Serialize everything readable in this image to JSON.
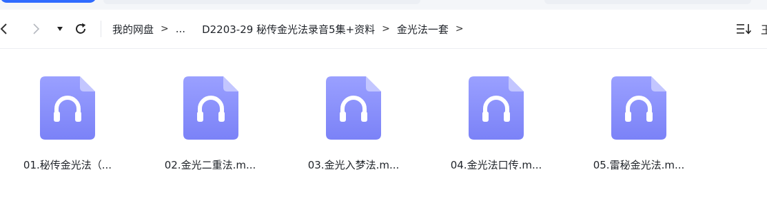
{
  "navigation": {
    "back_icon": "chevron-left-icon",
    "forward_icon": "chevron-right-icon",
    "dropdown_icon": "caret-down-icon",
    "refresh_icon": "refresh-icon"
  },
  "breadcrumb": {
    "items": [
      "我的网盘",
      "...",
      "D2203-29 秘传金光法录音5集+资料",
      "金光法一套"
    ],
    "separator": ">"
  },
  "toolbar": {
    "sort_icon": "sort-list-icon",
    "more_label": "王"
  },
  "files": [
    {
      "name": "01.秘传金光法（...",
      "icon": "audio-file-icon"
    },
    {
      "name": "02.金光二重法.m...",
      "icon": "audio-file-icon"
    },
    {
      "name": "03.金光入梦法.m...",
      "icon": "audio-file-icon"
    },
    {
      "name": "04.金光法口传.m...",
      "icon": "audio-file-icon"
    },
    {
      "name": "05.雷秘金光法.m...",
      "icon": "audio-file-icon"
    }
  ],
  "colors": {
    "icon_top": "#9aa0ff",
    "icon_bottom": "#7b82f7",
    "icon_fold": "#c3c6ff",
    "accent": "#2f6bff"
  }
}
